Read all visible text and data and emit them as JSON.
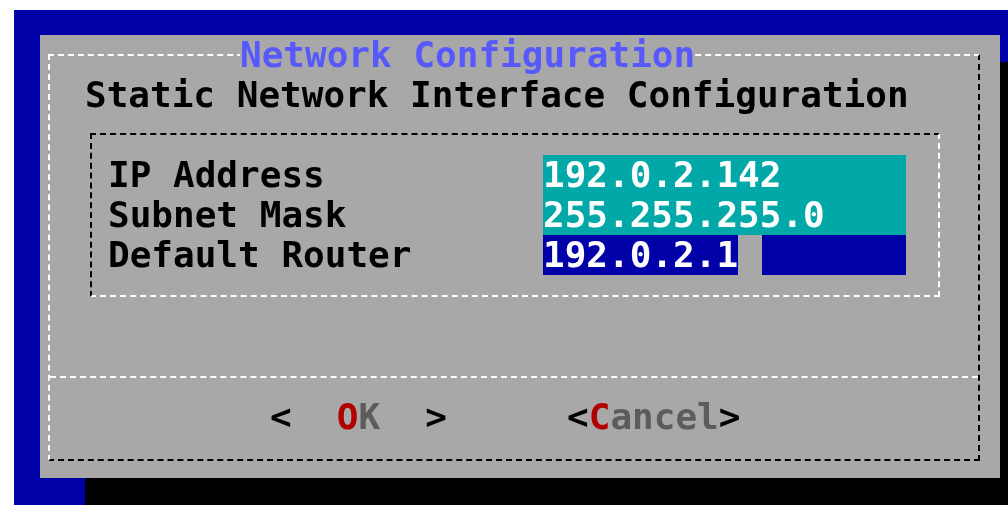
{
  "dialog": {
    "title": "Network Configuration",
    "subtitle": "Static Network Interface Configuration",
    "fields": [
      {
        "label": "IP Address",
        "value": "192.0.2.142",
        "selected": false
      },
      {
        "label": "Subnet Mask",
        "value": "255.255.255.0",
        "selected": false
      },
      {
        "label": "Default Router",
        "value": "192.0.2.1",
        "selected": true
      }
    ],
    "buttons": [
      {
        "open": "<",
        "hotkey": "O",
        "rest": "K",
        "close": ">",
        "kind": "spaced"
      },
      {
        "open": "<",
        "hotkey": "C",
        "rest": "ancel",
        "close": ">",
        "kind": "tight"
      }
    ]
  }
}
